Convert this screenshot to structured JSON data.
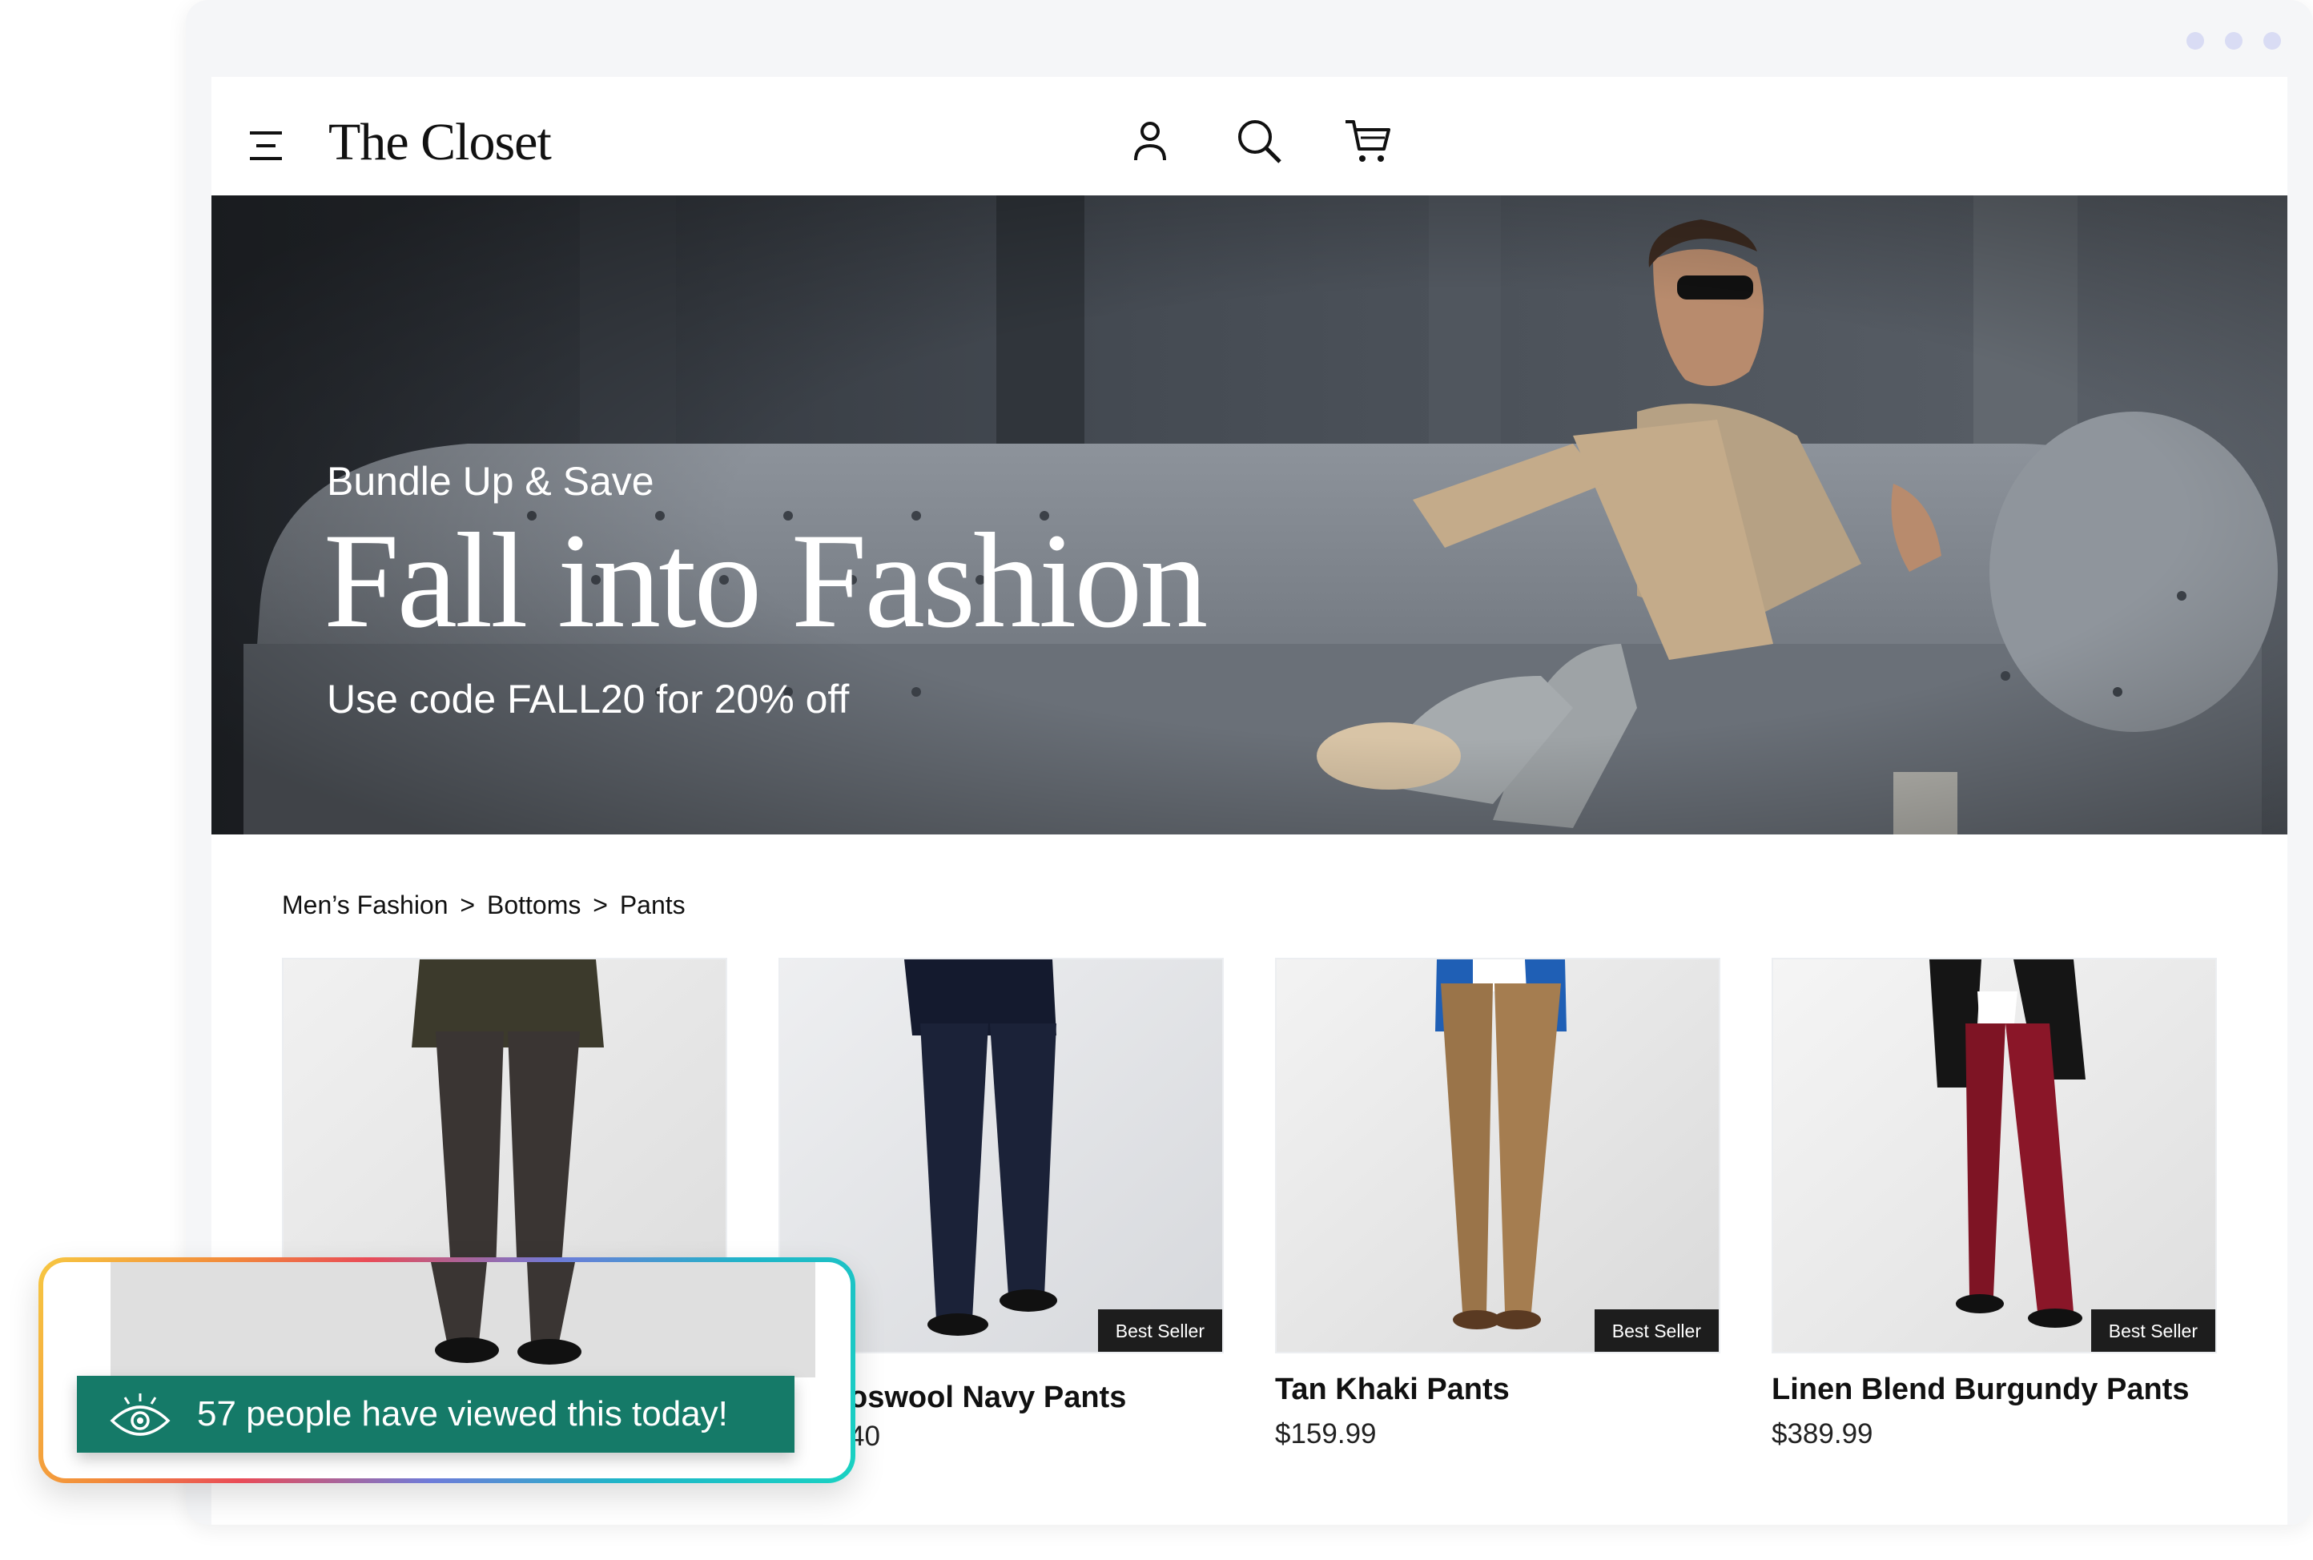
{
  "header": {
    "logo": "The Closet",
    "icons": [
      "menu-icon",
      "account-icon",
      "search-icon",
      "cart-icon"
    ]
  },
  "hero": {
    "subtitle": "Bundle Up & Save",
    "title": "Fall into Fashion",
    "promo": "Use code FALL20 for 20% off"
  },
  "breadcrumb": {
    "items": [
      "Men’s Fashion",
      "Bottoms",
      "Pants"
    ],
    "separator": ">"
  },
  "products": [
    {
      "name": "",
      "price": "",
      "badge": ""
    },
    {
      "name": "oswool Navy Pants",
      "price": "40",
      "badge": "Best Seller"
    },
    {
      "name": "Tan Khaki Pants",
      "price": "$159.99",
      "badge": "Best Seller"
    },
    {
      "name": "Linen Blend Burgundy Pants",
      "price": "$389.99",
      "badge": "Best Seller"
    }
  ],
  "social_proof": {
    "message": "57 people have viewed this today!",
    "icon": "eye-icon"
  },
  "colors": {
    "accent_green": "#157a68",
    "badge_bg": "#1d1d1d",
    "window_dot": "#d9dcf4"
  }
}
